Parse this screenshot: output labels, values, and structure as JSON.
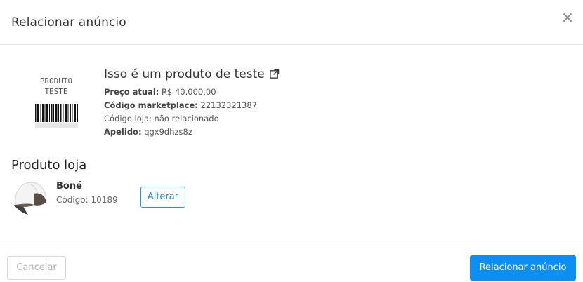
{
  "modal": {
    "title": "Relacionar anúncio",
    "close_glyph": "×"
  },
  "marketplace_product": {
    "image_text_line1": "PRODUTO",
    "image_text_line2": "TESTE",
    "name": "Isso é um produto de teste",
    "link_icon": "external-link-icon",
    "price_label": "Preço atual:",
    "price_value": "R$ 40.000,00",
    "marketplace_code_label": "Código marketplace:",
    "marketplace_code_value": "22132321387",
    "store_code_text": "Código loja: não relacionado",
    "nickname_label": "Apelido:",
    "nickname_value": "qgx9dhzs8z"
  },
  "store_product": {
    "section_title": "Produto loja",
    "name": "Boné",
    "code_text": "Código: 10189",
    "change_label": "Alterar"
  },
  "footer": {
    "cancel_label": "Cancelar",
    "submit_label": "Relacionar anúncio"
  },
  "colors": {
    "primary": "#0d8ef2",
    "outline_primary": "#2b8fd6",
    "divider": "#e6e6e6"
  }
}
